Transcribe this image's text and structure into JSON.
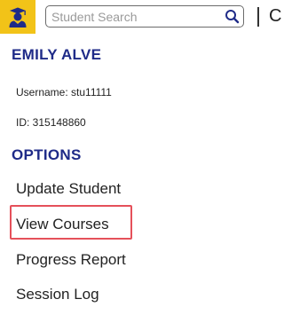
{
  "header": {
    "logo_icon": "graduation-cap-student-icon",
    "accent_color": "#f2c318",
    "search": {
      "placeholder": "Student Search",
      "value": "",
      "icon": "search-icon"
    },
    "cut_text": "C"
  },
  "student": {
    "name": "EMILY ALVE",
    "username_label": "Username: stu11111",
    "id_label": "ID: 315148860"
  },
  "options": {
    "heading": "OPTIONS",
    "items": [
      {
        "label": "Update Student"
      },
      {
        "label": "View Courses",
        "highlighted": true
      },
      {
        "label": "Progress Report"
      },
      {
        "label": "Session Log"
      }
    ]
  },
  "colors": {
    "heading": "#1f2b88",
    "highlight_border": "#e5505a"
  }
}
